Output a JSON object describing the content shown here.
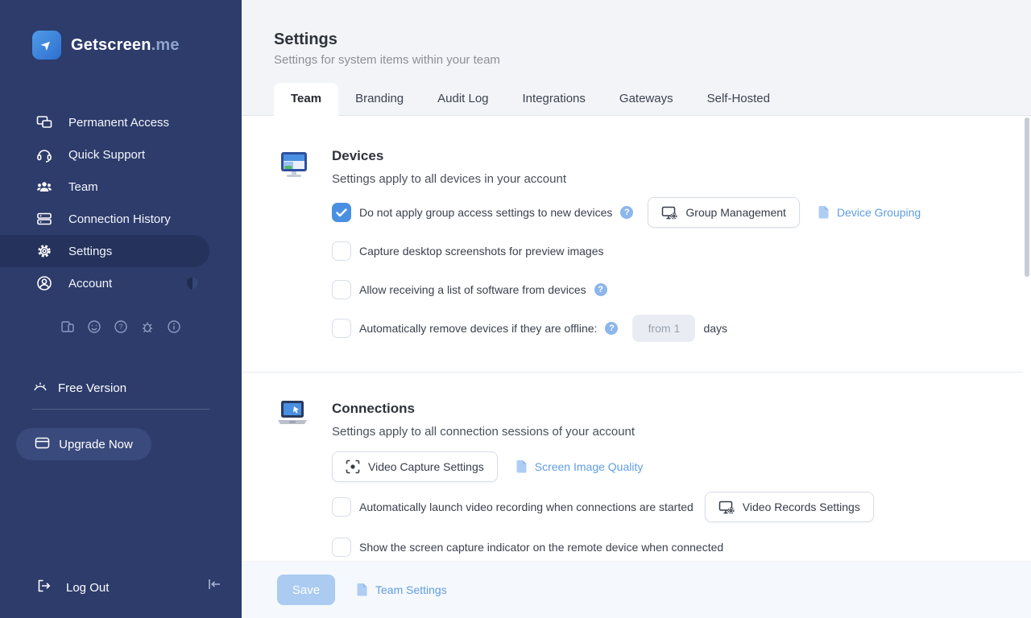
{
  "sidebar": {
    "logo_text": "Getscreen",
    "logo_suffix": ".me",
    "items": [
      {
        "label": "Permanent Access",
        "active": false
      },
      {
        "label": "Quick Support",
        "active": false
      },
      {
        "label": "Team",
        "active": false
      },
      {
        "label": "Connection History",
        "active": false
      },
      {
        "label": "Settings",
        "active": true
      },
      {
        "label": "Account",
        "active": false,
        "badge": "shield"
      }
    ],
    "utility_icons": [
      "devices-icon",
      "user-face-icon",
      "help-icon",
      "bug-icon",
      "info-icon"
    ],
    "free_version_label": "Free Version",
    "upgrade_label": "Upgrade Now",
    "logout_label": "Log Out"
  },
  "header": {
    "title": "Settings",
    "subtitle": "Settings for system items within your team"
  },
  "tabs": {
    "items": [
      {
        "label": "Team",
        "active": true
      },
      {
        "label": "Branding",
        "active": false
      },
      {
        "label": "Audit Log",
        "active": false
      },
      {
        "label": "Integrations",
        "active": false
      },
      {
        "label": "Gateways",
        "active": false
      },
      {
        "label": "Self-Hosted",
        "active": false
      }
    ]
  },
  "devices": {
    "title": "Devices",
    "subtitle": "Settings apply to all devices in your account",
    "rows": [
      {
        "label": "Do not apply group access settings to new devices",
        "checked": true,
        "has_help": true
      },
      {
        "label": "Capture desktop screenshots for preview images",
        "checked": false
      },
      {
        "label": "Allow receiving a list of software from devices",
        "checked": false,
        "has_help": true
      },
      {
        "label": "Automatically remove devices if they are offline:",
        "checked": false,
        "has_help": true,
        "input_value": "from 1",
        "suffix": "days"
      }
    ],
    "group_management_button": "Group Management",
    "device_grouping_link": "Device Grouping"
  },
  "connections": {
    "title": "Connections",
    "subtitle": "Settings apply to all connection sessions of your account",
    "video_capture_button": "Video Capture Settings",
    "screen_quality_link": "Screen Image Quality",
    "rows": [
      {
        "label": "Automatically launch video recording when connections are started",
        "checked": false
      },
      {
        "label": "Show the screen capture indicator on the remote device when connected",
        "checked": false
      }
    ],
    "video_records_button": "Video Records Settings"
  },
  "footer": {
    "save_label": "Save",
    "team_settings_link": "Team Settings"
  },
  "colors": {
    "accent": "#4a90e2",
    "link": "#5f9de4",
    "sidebar": "#2d3c6b",
    "sidebar_active": "#24325c"
  }
}
